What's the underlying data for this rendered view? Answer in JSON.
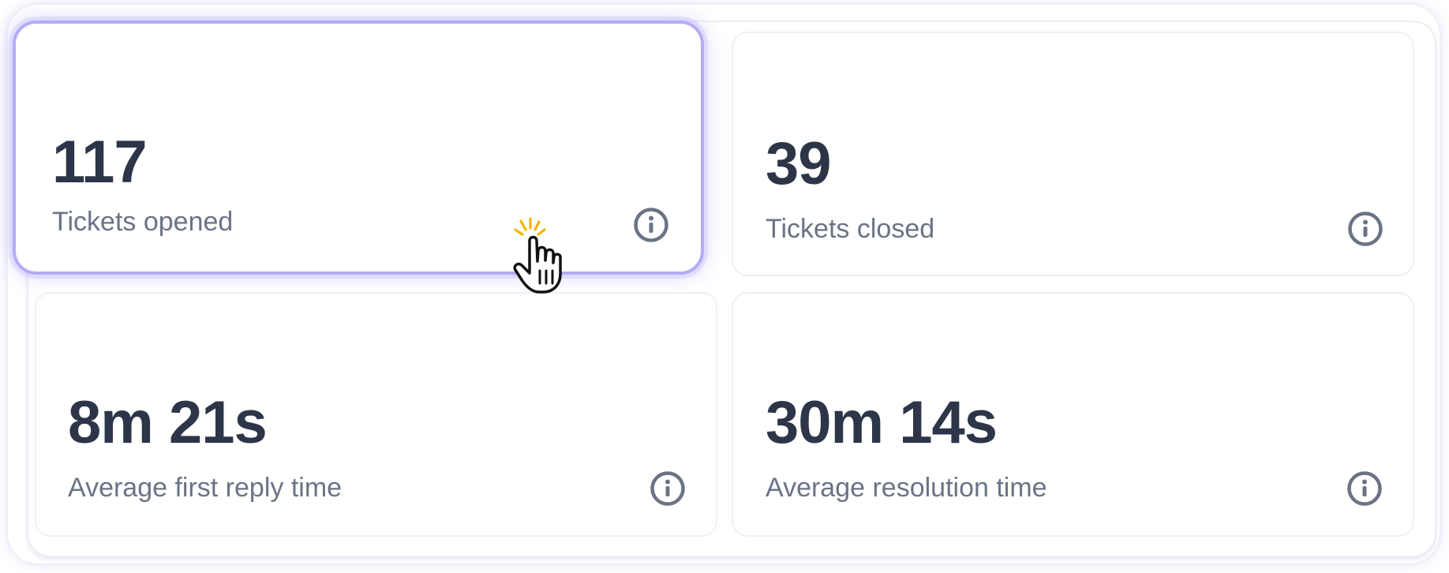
{
  "metrics": [
    {
      "value": "117",
      "label": "Tickets opened",
      "icon": "info-icon"
    },
    {
      "value": "39",
      "label": "Tickets closed",
      "icon": "info-icon"
    },
    {
      "value": "8m 21s",
      "label": "Average first reply time",
      "icon": "info-icon"
    },
    {
      "value": "30m 14s",
      "label": "Average resolution time",
      "icon": "info-icon"
    }
  ],
  "colors": {
    "value_text": "#2d3648",
    "label_text": "#6b7385",
    "highlight_border": "#b3acf6",
    "click_burst": "#f5b400"
  },
  "cursor": {
    "icon": "hand-pointer-cursor-icon"
  }
}
